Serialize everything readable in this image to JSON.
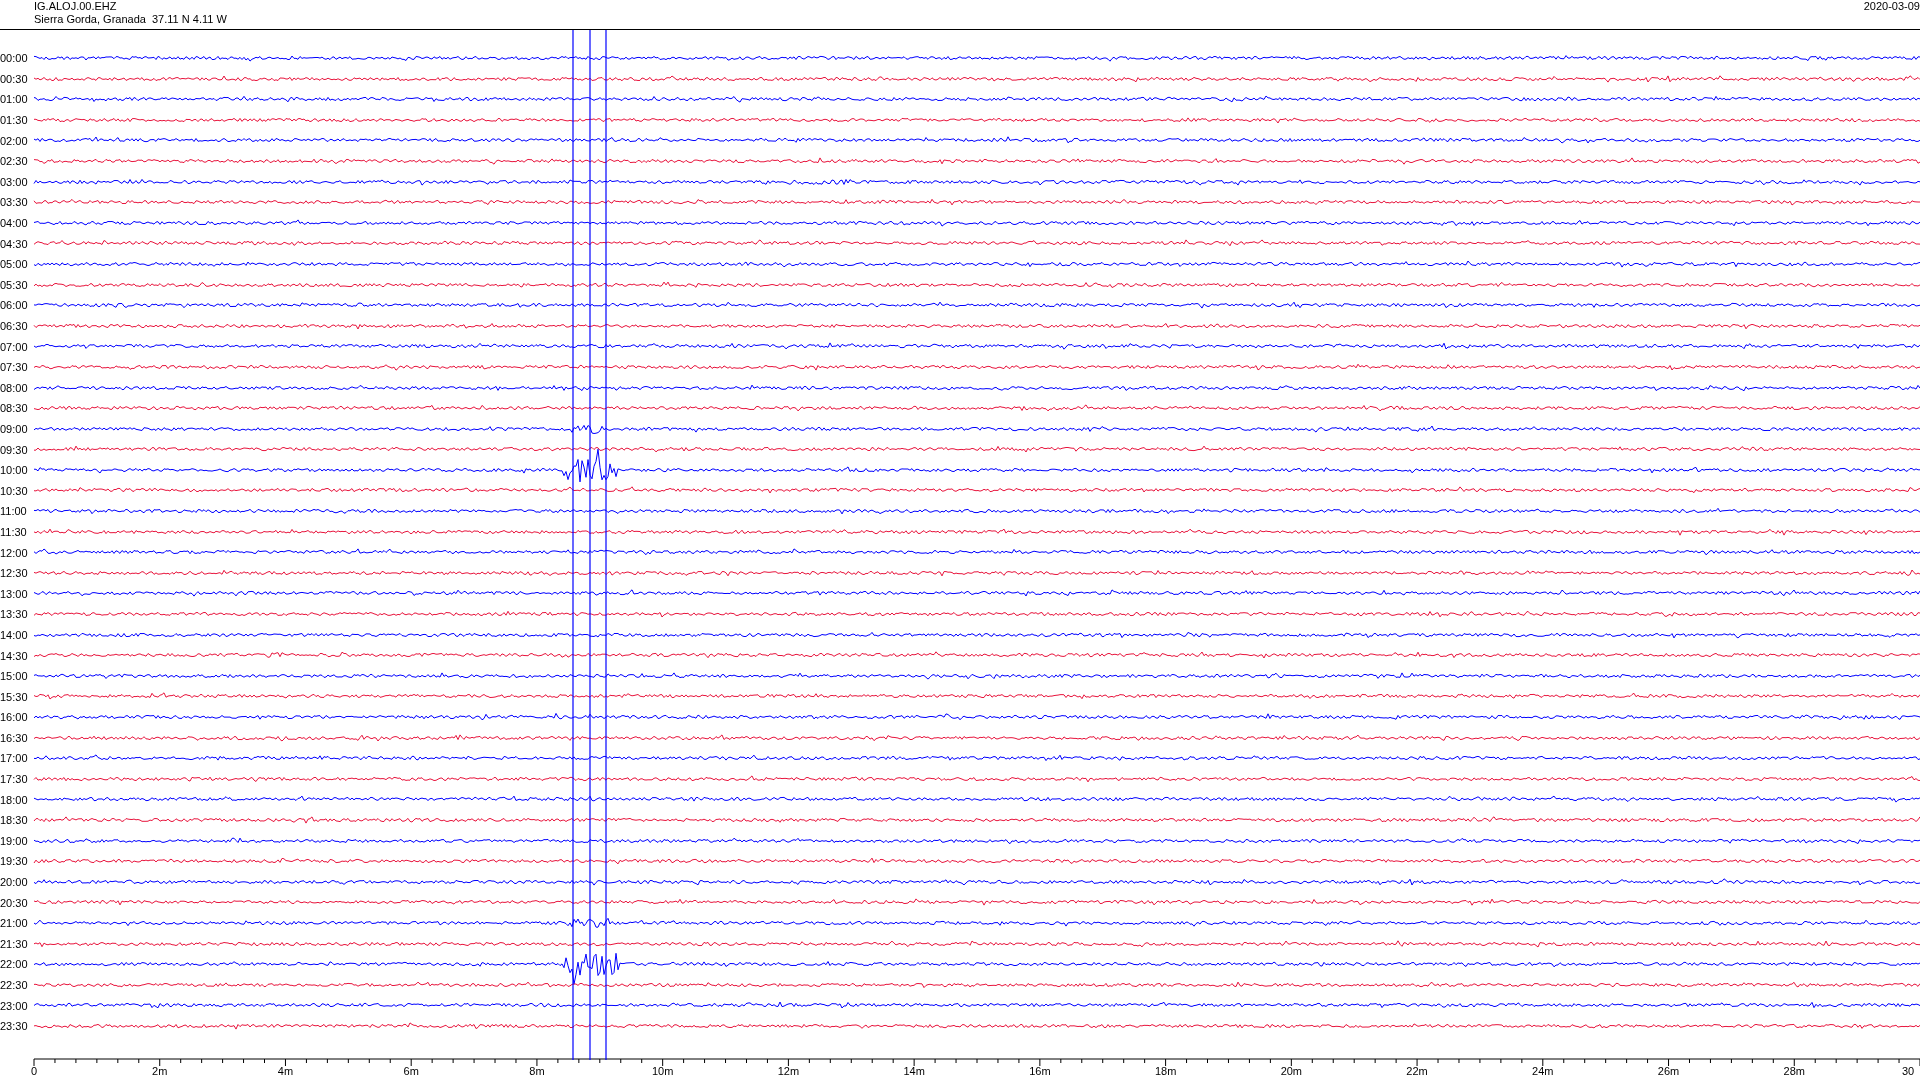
{
  "header": {
    "station": "IG.ALOJ.00.EHZ",
    "location": "Sierra Gorda, Granada  37.11 N 4.11 W",
    "date": "2020-03-09"
  },
  "rows": [
    {
      "time": "00:00",
      "color": "#0000ff"
    },
    {
      "time": "00:30",
      "color": "#e8143c"
    },
    {
      "time": "01:00",
      "color": "#0000ff"
    },
    {
      "time": "01:30",
      "color": "#e8143c"
    },
    {
      "time": "02:00",
      "color": "#0000ff"
    },
    {
      "time": "02:30",
      "color": "#e8143c"
    },
    {
      "time": "03:00",
      "color": "#0000ff"
    },
    {
      "time": "03:30",
      "color": "#e8143c"
    },
    {
      "time": "04:00",
      "color": "#0000ff"
    },
    {
      "time": "04:30",
      "color": "#e8143c"
    },
    {
      "time": "05:00",
      "color": "#0000ff"
    },
    {
      "time": "05:30",
      "color": "#e8143c"
    },
    {
      "time": "06:00",
      "color": "#0000ff"
    },
    {
      "time": "06:30",
      "color": "#e8143c"
    },
    {
      "time": "07:00",
      "color": "#0000ff"
    },
    {
      "time": "07:30",
      "color": "#e8143c"
    },
    {
      "time": "08:00",
      "color": "#0000ff"
    },
    {
      "time": "08:30",
      "color": "#e8143c"
    },
    {
      "time": "09:00",
      "color": "#0000ff"
    },
    {
      "time": "09:30",
      "color": "#e8143c"
    },
    {
      "time": "10:00",
      "color": "#0000ff"
    },
    {
      "time": "10:30",
      "color": "#e8143c"
    },
    {
      "time": "11:00",
      "color": "#0000ff"
    },
    {
      "time": "11:30",
      "color": "#e8143c"
    },
    {
      "time": "12:00",
      "color": "#0000ff"
    },
    {
      "time": "12:30",
      "color": "#e8143c"
    },
    {
      "time": "13:00",
      "color": "#0000ff"
    },
    {
      "time": "13:30",
      "color": "#e8143c"
    },
    {
      "time": "14:00",
      "color": "#0000ff"
    },
    {
      "time": "14:30",
      "color": "#e8143c"
    },
    {
      "time": "15:00",
      "color": "#0000ff"
    },
    {
      "time": "15:30",
      "color": "#e8143c"
    },
    {
      "time": "16:00",
      "color": "#0000ff"
    },
    {
      "time": "16:30",
      "color": "#e8143c"
    },
    {
      "time": "17:00",
      "color": "#0000ff"
    },
    {
      "time": "17:30",
      "color": "#e8143c"
    },
    {
      "time": "18:00",
      "color": "#0000ff"
    },
    {
      "time": "18:30",
      "color": "#e8143c"
    },
    {
      "time": "19:00",
      "color": "#0000ff"
    },
    {
      "time": "19:30",
      "color": "#e8143c"
    },
    {
      "time": "20:00",
      "color": "#0000ff"
    },
    {
      "time": "20:30",
      "color": "#e8143c"
    },
    {
      "time": "21:00",
      "color": "#0000ff"
    },
    {
      "time": "21:30",
      "color": "#e8143c"
    },
    {
      "time": "22:00",
      "color": "#0000ff"
    },
    {
      "time": "22:30",
      "color": "#e8143c"
    },
    {
      "time": "23:00",
      "color": "#0000ff"
    },
    {
      "time": "23:30",
      "color": "#e8143c"
    }
  ],
  "x_axis": {
    "ticks": [
      "0",
      "2m",
      "4m",
      "6m",
      "8m",
      "10m",
      "12m",
      "14m",
      "16m",
      "18m",
      "20m",
      "22m",
      "24m",
      "26m",
      "28m",
      "30"
    ]
  }
}
